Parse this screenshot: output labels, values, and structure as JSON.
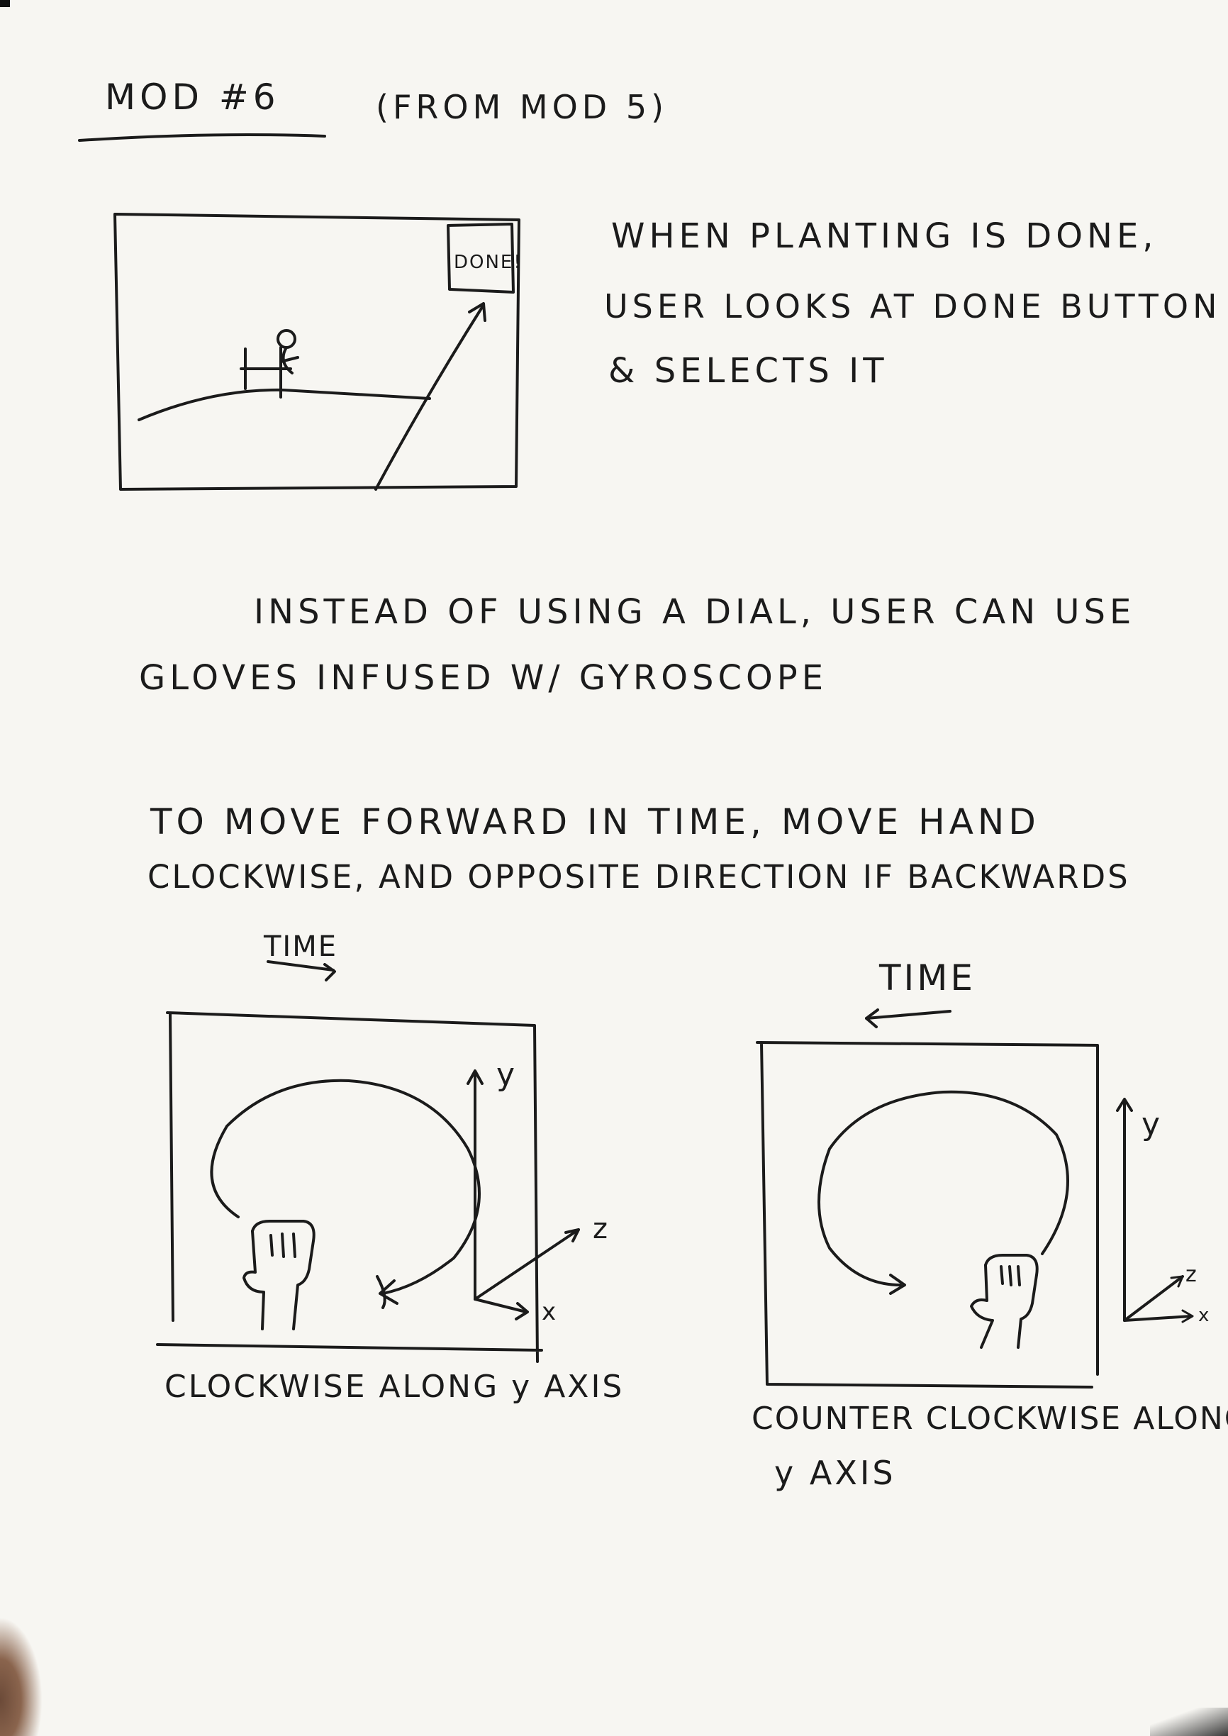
{
  "page": {
    "title": "MOD #6",
    "subtitle": "(FROM MOD 5)"
  },
  "sketch1": {
    "button_label": "DONE!",
    "note_lines": [
      "WHEN PLANTING IS DONE,",
      "USER LOOKS AT DONE BUTTON",
      "& SELECTS IT"
    ]
  },
  "paragraph1": [
    "INSTEAD OF USING A DIAL, USER CAN USE",
    "GLOVES INFUSED W/ GYROSCOPE"
  ],
  "paragraph2": [
    "TO MOVE FORWARD IN TIME, MOVE HAND",
    "CLOCKWISE, AND OPPOSITE DIRECTION IF BACKWARDS"
  ],
  "diagram_left": {
    "time_label": "TIME",
    "axes": {
      "y": "y",
      "z": "z",
      "x": "x"
    },
    "caption": "CLOCKWISE ALONG y AXIS"
  },
  "diagram_right": {
    "time_label": "TIME",
    "axes": {
      "y": "y",
      "z": "z",
      "x": "x"
    },
    "caption_lines": [
      "COUNTER CLOCKWISE ALONG",
      "y AXIS"
    ]
  }
}
